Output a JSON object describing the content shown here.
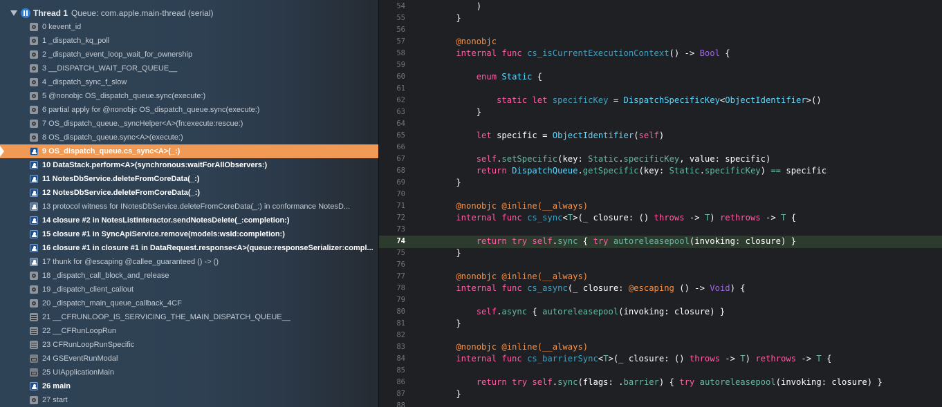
{
  "thread": {
    "name": "Thread 1",
    "queue": "Queue: com.apple.main-thread (serial)"
  },
  "frames": [
    {
      "label": "0 kevent_id",
      "kind": "gear",
      "style": "normal"
    },
    {
      "label": "1 _dispatch_kq_poll",
      "kind": "gear",
      "style": "normal"
    },
    {
      "label": "2 _dispatch_event_loop_wait_for_ownership",
      "kind": "gear",
      "style": "normal"
    },
    {
      "label": "3 __DISPATCH_WAIT_FOR_QUEUE__",
      "kind": "gear",
      "style": "normal"
    },
    {
      "label": "4 _dispatch_sync_f_slow",
      "kind": "gear",
      "style": "normal"
    },
    {
      "label": "5 @nonobjc OS_dispatch_queue.sync(execute:)",
      "kind": "gear",
      "style": "normal"
    },
    {
      "label": "6 partial apply for @nonobjc OS_dispatch_queue.sync(execute:)",
      "kind": "gear",
      "style": "normal"
    },
    {
      "label": "7 OS_dispatch_queue._syncHelper<A>(fn:execute:rescue:)",
      "kind": "gear",
      "style": "normal"
    },
    {
      "label": "8 OS_dispatch_queue.sync<A>(execute:)",
      "kind": "gear",
      "style": "normal"
    },
    {
      "label": "9 OS_dispatch_queue.cs_sync<A>(_:)",
      "kind": "person",
      "style": "selected"
    },
    {
      "label": "10 DataStack.perform<A>(synchronous:waitForAllObservers:)",
      "kind": "person",
      "style": "user"
    },
    {
      "label": "11 NotesDbService.deleteFromCoreData(_:)",
      "kind": "person",
      "style": "user"
    },
    {
      "label": "12 NotesDbService.deleteFromCoreData(_:)",
      "kind": "person",
      "style": "user"
    },
    {
      "label": "13 protocol witness for INotesDbService.deleteFromCoreData(_:) in conformance NotesD...",
      "kind": "person-dim",
      "style": "normal"
    },
    {
      "label": "14 closure #2 in NotesListInteractor.sendNotesDelete(_:completion:)",
      "kind": "person",
      "style": "user"
    },
    {
      "label": "15 closure #1 in SyncApiService.remove(models:wsId:completion:)",
      "kind": "person",
      "style": "user"
    },
    {
      "label": "16 closure #1 in closure #1 in DataRequest.response<A>(queue:responseSerializer:compl...",
      "kind": "person",
      "style": "user"
    },
    {
      "label": "17 thunk for @escaping @callee_guaranteed () -> ()",
      "kind": "person-dim",
      "style": "normal"
    },
    {
      "label": "18 _dispatch_call_block_and_release",
      "kind": "gear",
      "style": "normal"
    },
    {
      "label": "19 _dispatch_client_callout",
      "kind": "gear",
      "style": "normal"
    },
    {
      "label": "20 _dispatch_main_queue_callback_4CF",
      "kind": "gear",
      "style": "normal"
    },
    {
      "label": "21 __CFRUNLOOP_IS_SERVICING_THE_MAIN_DISPATCH_QUEUE__",
      "kind": "lines",
      "style": "normal"
    },
    {
      "label": "22 __CFRunLoopRun",
      "kind": "lines",
      "style": "normal"
    },
    {
      "label": "23 CFRunLoopRunSpecific",
      "kind": "lines",
      "style": "normal"
    },
    {
      "label": "24 GSEventRunModal",
      "kind": "case",
      "style": "normal"
    },
    {
      "label": "25 UIApplicationMain",
      "kind": "case",
      "style": "normal"
    },
    {
      "label": "26 main",
      "kind": "person",
      "style": "user"
    },
    {
      "label": "27 start",
      "kind": "gear",
      "style": "normal"
    }
  ],
  "colors": {
    "selected_frame": "#f19a55",
    "current_line": "#2d3b2f",
    "keyword": "#fc5fa3",
    "attribute": "#fd8f3f",
    "type": "#5dd8ff",
    "declaration": "#41a1c0"
  },
  "code": {
    "current_line": "74",
    "lines": [
      {
        "n": "54",
        "tokens": [
          [
            "plain",
            "        )"
          ]
        ]
      },
      {
        "n": "55",
        "tokens": [
          [
            "plain",
            "    }"
          ]
        ]
      },
      {
        "n": "56",
        "tokens": []
      },
      {
        "n": "57",
        "tokens": [
          [
            "attr",
            "    @nonobjc"
          ]
        ]
      },
      {
        "n": "58",
        "tokens": [
          [
            "kw",
            "    internal func "
          ],
          [
            "def",
            "cs_isCurrentExecutionContext"
          ],
          [
            "plain",
            "() -> "
          ],
          [
            "sys",
            "Bool"
          ],
          [
            "plain",
            " {"
          ]
        ]
      },
      {
        "n": "59",
        "tokens": []
      },
      {
        "n": "60",
        "tokens": [
          [
            "kw",
            "        enum "
          ],
          [
            "type",
            "Static"
          ],
          [
            "plain",
            " {"
          ]
        ]
      },
      {
        "n": "61",
        "tokens": []
      },
      {
        "n": "62",
        "tokens": [
          [
            "kw",
            "            static let "
          ],
          [
            "def",
            "specificKey"
          ],
          [
            "plain",
            " = "
          ],
          [
            "type",
            "DispatchSpecificKey"
          ],
          [
            "plain",
            "<"
          ],
          [
            "type",
            "ObjectIdentifier"
          ],
          [
            "plain",
            ">()"
          ]
        ]
      },
      {
        "n": "63",
        "tokens": [
          [
            "plain",
            "        }"
          ]
        ]
      },
      {
        "n": "64",
        "tokens": []
      },
      {
        "n": "65",
        "tokens": [
          [
            "kw",
            "        let "
          ],
          [
            "plain",
            "specific = "
          ],
          [
            "type",
            "ObjectIdentifier"
          ],
          [
            "plain",
            "("
          ],
          [
            "kw",
            "self"
          ],
          [
            "plain",
            ")"
          ]
        ]
      },
      {
        "n": "66",
        "tokens": []
      },
      {
        "n": "67",
        "tokens": [
          [
            "kw",
            "        self"
          ],
          [
            "plain",
            "."
          ],
          [
            "fn",
            "setSpecific"
          ],
          [
            "plain",
            "(key: "
          ],
          [
            "fn",
            "Static"
          ],
          [
            "plain",
            "."
          ],
          [
            "fn",
            "specificKey"
          ],
          [
            "plain",
            ", value: specific)"
          ]
        ]
      },
      {
        "n": "68",
        "tokens": [
          [
            "kw",
            "        return "
          ],
          [
            "type",
            "DispatchQueue"
          ],
          [
            "plain",
            "."
          ],
          [
            "fn",
            "getSpecific"
          ],
          [
            "plain",
            "(key: "
          ],
          [
            "fn",
            "Static"
          ],
          [
            "plain",
            "."
          ],
          [
            "fn",
            "specificKey"
          ],
          [
            "plain",
            ") "
          ],
          [
            "fn",
            "=="
          ],
          [
            "plain",
            " specific"
          ]
        ]
      },
      {
        "n": "69",
        "tokens": [
          [
            "plain",
            "    }"
          ]
        ]
      },
      {
        "n": "70",
        "tokens": []
      },
      {
        "n": "71",
        "tokens": [
          [
            "attr",
            "    @nonobjc @inline(__always)"
          ]
        ]
      },
      {
        "n": "72",
        "tokens": [
          [
            "kw",
            "    internal func "
          ],
          [
            "def",
            "cs_sync"
          ],
          [
            "plain",
            "<"
          ],
          [
            "fn",
            "T"
          ],
          [
            "plain",
            ">(_ closure: () "
          ],
          [
            "kw",
            "throws"
          ],
          [
            "plain",
            " -> "
          ],
          [
            "fn",
            "T"
          ],
          [
            "plain",
            ") "
          ],
          [
            "kw",
            "rethrows"
          ],
          [
            "plain",
            " -> "
          ],
          [
            "fn",
            "T"
          ],
          [
            "plain",
            " {"
          ]
        ]
      },
      {
        "n": "73",
        "tokens": []
      },
      {
        "n": "74",
        "tokens": [
          [
            "kw",
            "        return try self"
          ],
          [
            "plain",
            "."
          ],
          [
            "fn",
            "sync"
          ],
          [
            "plain",
            " { "
          ],
          [
            "kw",
            "try "
          ],
          [
            "fn",
            "autoreleasepool"
          ],
          [
            "plain",
            "(invoking: closure) }"
          ]
        ]
      },
      {
        "n": "75",
        "tokens": [
          [
            "plain",
            "    }"
          ]
        ]
      },
      {
        "n": "76",
        "tokens": []
      },
      {
        "n": "77",
        "tokens": [
          [
            "attr",
            "    @nonobjc @inline(__always)"
          ]
        ]
      },
      {
        "n": "78",
        "tokens": [
          [
            "kw",
            "    internal func "
          ],
          [
            "def",
            "cs_async"
          ],
          [
            "plain",
            "(_ closure: "
          ],
          [
            "attr",
            "@escaping"
          ],
          [
            "plain",
            " () -> "
          ],
          [
            "sys",
            "Void"
          ],
          [
            "plain",
            ") {"
          ]
        ]
      },
      {
        "n": "79",
        "tokens": []
      },
      {
        "n": "80",
        "tokens": [
          [
            "kw",
            "        self"
          ],
          [
            "plain",
            "."
          ],
          [
            "fn",
            "async"
          ],
          [
            "plain",
            " { "
          ],
          [
            "fn",
            "autoreleasepool"
          ],
          [
            "plain",
            "(invoking: closure) }"
          ]
        ]
      },
      {
        "n": "81",
        "tokens": [
          [
            "plain",
            "    }"
          ]
        ]
      },
      {
        "n": "82",
        "tokens": []
      },
      {
        "n": "83",
        "tokens": [
          [
            "attr",
            "    @nonobjc @inline(__always)"
          ]
        ]
      },
      {
        "n": "84",
        "tokens": [
          [
            "kw",
            "    internal func "
          ],
          [
            "def",
            "cs_barrierSync"
          ],
          [
            "plain",
            "<"
          ],
          [
            "fn",
            "T"
          ],
          [
            "plain",
            ">(_ closure: () "
          ],
          [
            "kw",
            "throws"
          ],
          [
            "plain",
            " -> "
          ],
          [
            "fn",
            "T"
          ],
          [
            "plain",
            ") "
          ],
          [
            "kw",
            "rethrows"
          ],
          [
            "plain",
            " -> "
          ],
          [
            "fn",
            "T"
          ],
          [
            "plain",
            " {"
          ]
        ]
      },
      {
        "n": "85",
        "tokens": []
      },
      {
        "n": "86",
        "tokens": [
          [
            "kw",
            "        return try self"
          ],
          [
            "plain",
            "."
          ],
          [
            "fn",
            "sync"
          ],
          [
            "plain",
            "(flags: ."
          ],
          [
            "fn",
            "barrier"
          ],
          [
            "plain",
            ") { "
          ],
          [
            "kw",
            "try "
          ],
          [
            "fn",
            "autoreleasepool"
          ],
          [
            "plain",
            "(invoking: closure) }"
          ]
        ]
      },
      {
        "n": "87",
        "tokens": [
          [
            "plain",
            "    }"
          ]
        ]
      },
      {
        "n": "88",
        "tokens": []
      }
    ]
  }
}
